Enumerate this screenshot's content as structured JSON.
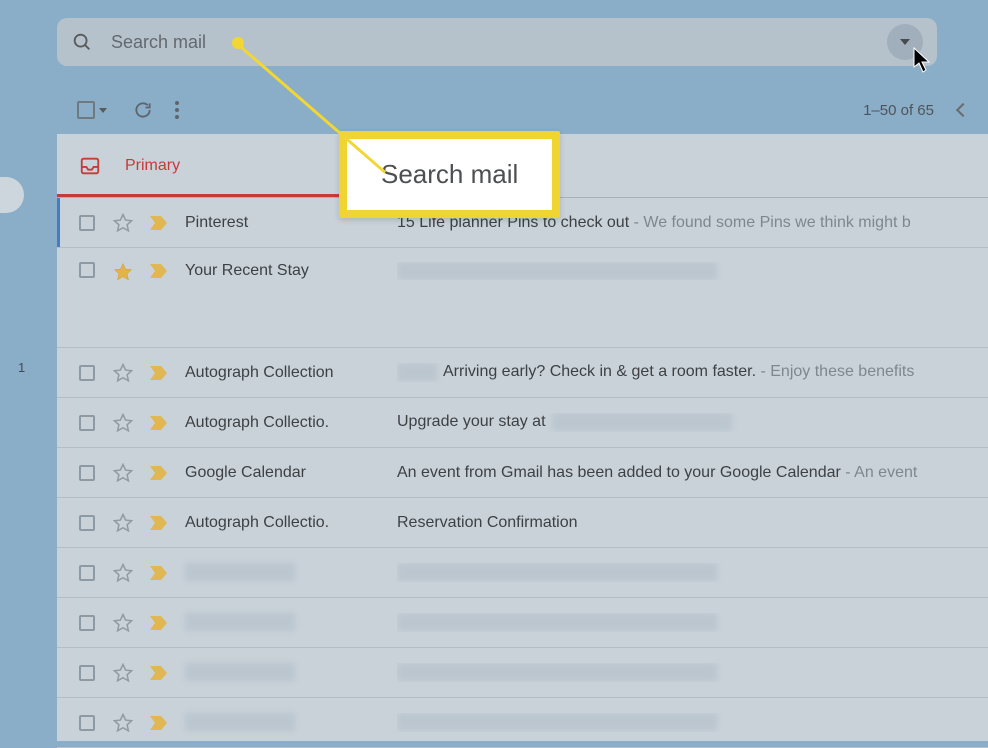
{
  "search": {
    "placeholder": "Search mail"
  },
  "toolbar": {
    "pager": "1–50 of 65"
  },
  "tabs": {
    "primary_label": "Primary"
  },
  "callout": {
    "text": "Search mail"
  },
  "side": {
    "num": "1"
  },
  "rows": [
    {
      "unread": true,
      "starred": false,
      "sender": "Pinterest",
      "subject": "15 Life planner Pins to check out",
      "snippet": " - We found some Pins we think might b"
    },
    {
      "unread": false,
      "starred": true,
      "tall": true,
      "sender": "Your Recent Stay",
      "subject": "",
      "snippet": "",
      "redacted_subject": true
    },
    {
      "unread": false,
      "starred": false,
      "sender": "Autograph Collection",
      "subject_prefix_redacted": true,
      "subject": "Arriving early? Check in & get a room faster.",
      "snippet": " - Enjoy these benefits "
    },
    {
      "unread": false,
      "starred": false,
      "sender": "Autograph Collectio.",
      "subject": "Upgrade your stay at ",
      "snippet": "",
      "trailing_redacted": true
    },
    {
      "unread": false,
      "starred": false,
      "sender": "Google Calendar",
      "subject": "An event from Gmail has been added to your Google Calendar",
      "snippet": " - An event"
    },
    {
      "unread": false,
      "starred": false,
      "sender": "Autograph Collectio.",
      "subject": "Reservation Confirmation",
      "snippet": ""
    },
    {
      "unread": false,
      "starred": false,
      "redacted_sender": true,
      "sender": "",
      "subject": "",
      "snippet": "",
      "redacted_subject": true
    },
    {
      "unread": false,
      "starred": false,
      "redacted_sender": true,
      "sender": "",
      "subject": "",
      "snippet": "",
      "redacted_subject": true
    },
    {
      "unread": false,
      "starred": false,
      "redacted_sender": true,
      "sender": "",
      "subject": "",
      "snippet": "",
      "redacted_subject": true
    },
    {
      "unread": false,
      "starred": false,
      "redacted_sender": true,
      "sender": "",
      "subject": "",
      "snippet": "",
      "redacted_subject": true
    }
  ]
}
